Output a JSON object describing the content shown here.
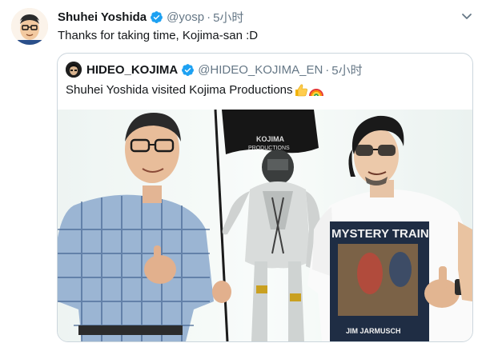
{
  "tweet": {
    "author_name": "Shuhei Yoshida",
    "handle": "@yosp",
    "separator": "·",
    "time": "5小时",
    "text": "Thanks for taking time, Kojima-san :D"
  },
  "quoted_tweet": {
    "author_name": "HIDEO_KOJIMA",
    "handle": "@HIDEO_KOJIMA_EN",
    "separator": "·",
    "time": "5小时",
    "text": "Shuhei Yoshida visited Kojima Productions"
  },
  "shirt_print": {
    "title": "MYSTERY TRAIN",
    "credit": "JIM JARMUSCH"
  },
  "flag_print": {
    "line1": "KOJIMA",
    "line2": "PRODUCTIONS"
  },
  "icons": {
    "verified": "verified-badge-icon",
    "caret": "chevron-down-icon",
    "thumbs_up": "thumbs-up-emoji",
    "rainbow": "rainbow-emoji"
  },
  "colors": {
    "verified": "#1da1f2",
    "muted": "#657786",
    "border": "#ccd6dd"
  }
}
